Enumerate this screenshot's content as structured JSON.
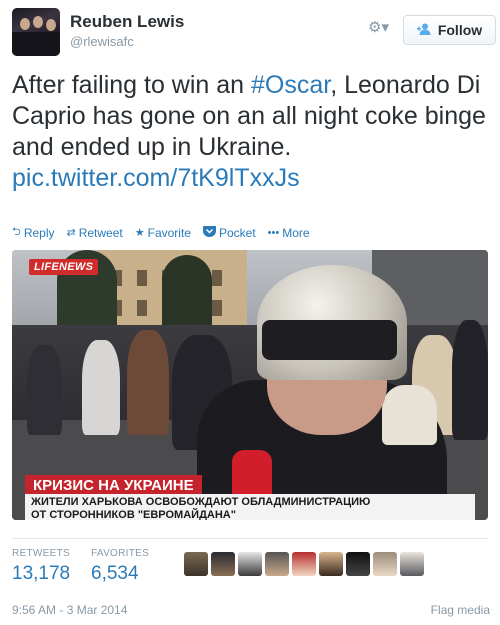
{
  "user": {
    "name": "Reuben Lewis",
    "handle": "@rlewisafc"
  },
  "header": {
    "gear_icon": "gear-icon",
    "follow_label": "Follow",
    "follow_icon": "add-person-icon"
  },
  "tweet": {
    "text_before": "After failing to win an ",
    "hashtag": "#Oscar",
    "text_after": ", Leonardo Di Caprio has gone on an all night coke binge and ended up in Ukraine. ",
    "link": "pic.twitter.com/7tK9lTxxJs"
  },
  "actions": [
    {
      "label": "Reply",
      "icon": "reply-icon"
    },
    {
      "label": "Retweet",
      "icon": "retweet-icon"
    },
    {
      "label": "Favorite",
      "icon": "star-icon"
    },
    {
      "label": "Pocket",
      "icon": "pocket-icon"
    },
    {
      "label": "More",
      "icon": "more-dots-icon"
    }
  ],
  "media": {
    "logo_text": "LIFENEWS",
    "banner_title": "КРИЗИС НА УКРАИНЕ",
    "banner_line1": "ЖИТЕЛИ ХАРЬКОВА ОСВОБОЖДАЮТ ОБЛАДМИНИСТРАЦИЮ",
    "banner_line2": "ОТ СТОРОННИКОВ \"ЕВРОМАЙДАНА\""
  },
  "stats": {
    "retweets_label": "RETWEETS",
    "retweets_value": "13,178",
    "favorites_label": "FAVORITES",
    "favorites_value": "6,534"
  },
  "footer": {
    "timestamp": "9:56 AM - 3 Mar 2014",
    "flag_label": "Flag media"
  },
  "colors": {
    "link": "#2b7bb9",
    "muted": "#8899a6",
    "banner_red": "#c6242c"
  }
}
